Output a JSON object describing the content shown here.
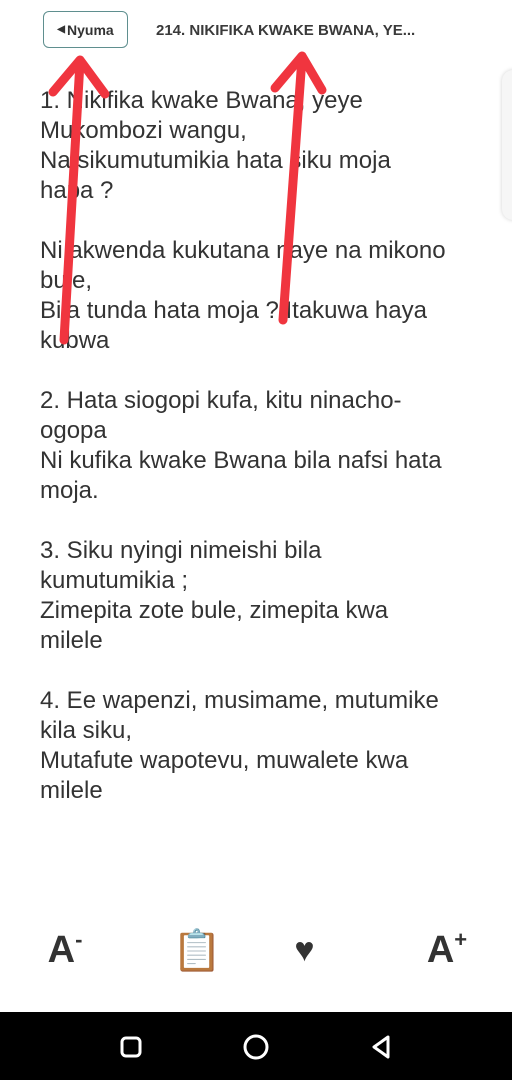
{
  "header": {
    "back_label": "Nyuma",
    "title": "214. NIKIFIKA KWAKE BWANA, YE..."
  },
  "lyrics": {
    "stanzas": [
      [
        "1. Nikifika kwake Bwana, yeye",
        "Mukombozi wangu,",
        "Na sikumutumikia hata siku moja",
        "hapa ?"
      ],
      [
        "Ni akwenda kukutana naye na mikono",
        "bule,",
        "Bila tunda hata moja ? Itakuwa haya",
        "kubwa"
      ],
      [
        "2. Hata siogopi kufa, kitu ninacho-",
        "ogopa",
        "Ni kufika kwake Bwana bila nafsi hata",
        "moja."
      ],
      [
        "3. Siku nyingi nimeishi bila",
        "kumutumikia ;",
        "Zimepita zote bule, zimepita kwa",
        "milele"
      ],
      [
        "4. Ee wapenzi, musimame, mutumike",
        "kila siku,",
        "Mutafute wapotevu, muwalete kwa",
        "milele"
      ]
    ]
  },
  "toolbar": {
    "font_decrease_glyph": "A",
    "font_decrease_sign": "-",
    "clipboard_icon": "📋",
    "heart_icon": "♥",
    "font_increase_glyph": "A",
    "font_increase_sign": "+"
  },
  "colors": {
    "annotation_arrow": "#f0353f",
    "text": "#333333",
    "navbar": "#000000"
  }
}
